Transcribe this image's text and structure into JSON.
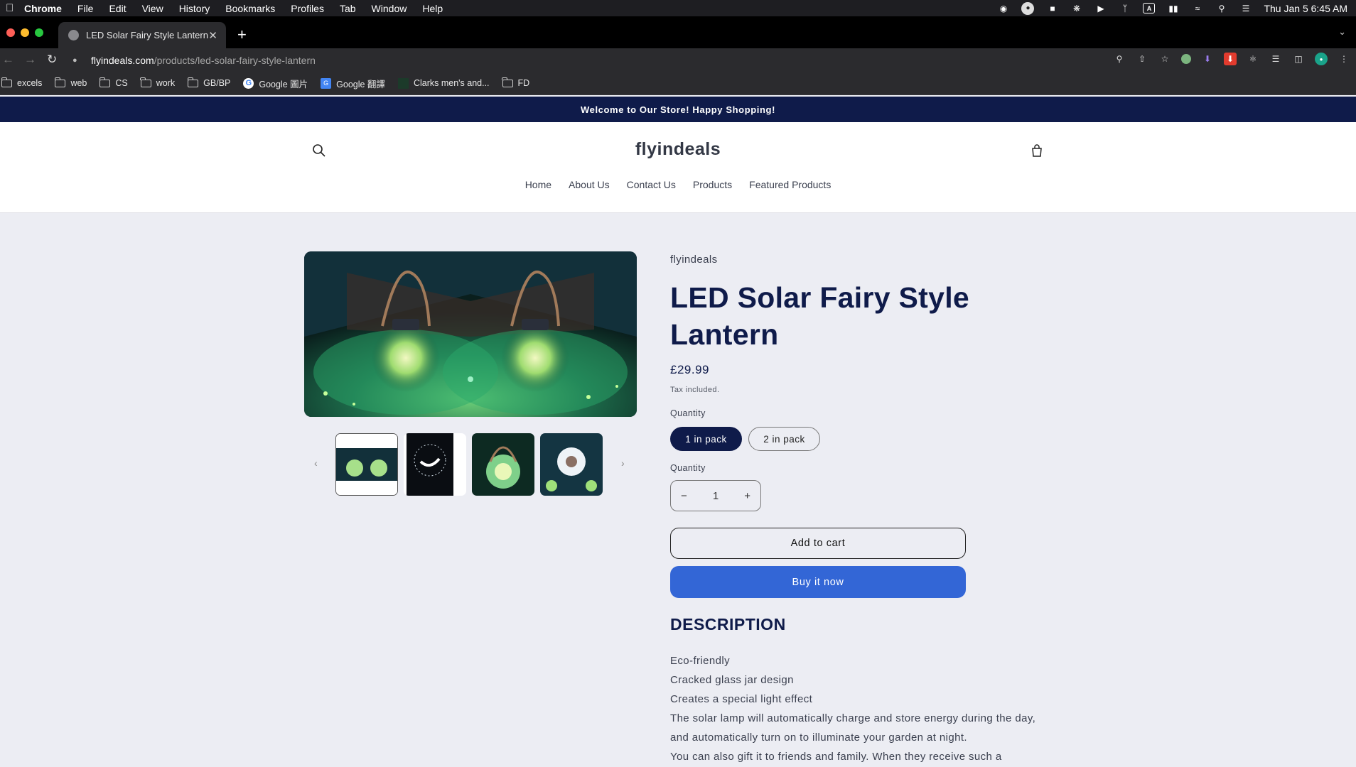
{
  "menubar": {
    "app": "Chrome",
    "items": [
      "File",
      "Edit",
      "View",
      "History",
      "Bookmarks",
      "Profiles",
      "Tab",
      "Window",
      "Help"
    ],
    "clock": "Thu Jan 5  6:45 AM",
    "tray_icons": [
      "wechat-icon",
      "user-circle-icon",
      "line-icon",
      "butterfly-icon",
      "play-icon",
      "bluetooth-icon",
      "keyboard-a-icon",
      "battery-icon",
      "wifi-icon",
      "spotlight-icon",
      "control-center-icon"
    ]
  },
  "tab": {
    "title": "LED Solar Fairy Style Lantern –"
  },
  "address": {
    "host": "flyindeals.com",
    "path": "/products/led-solar-fairy-style-lantern"
  },
  "bookmarks": [
    {
      "label": "excels",
      "icon": "folder-icon"
    },
    {
      "label": "web",
      "icon": "folder-icon"
    },
    {
      "label": "CS",
      "icon": "folder-icon"
    },
    {
      "label": "work",
      "icon": "folder-icon"
    },
    {
      "label": "GB/BP",
      "icon": "folder-icon"
    },
    {
      "label": "Google 圖片",
      "icon": "google-icon"
    },
    {
      "label": "Google 翻譯",
      "icon": "google-translate-icon"
    },
    {
      "label": "Clarks men's and...",
      "icon": "clarks-icon"
    },
    {
      "label": "FD",
      "icon": "folder-icon"
    }
  ],
  "store": {
    "announcement": "Welcome to Our Store! Happy Shopping!",
    "logo": "flyindeals",
    "nav": [
      "Home",
      "About Us",
      "Contact Us",
      "Products",
      "Featured Products"
    ]
  },
  "product": {
    "vendor": "flyindeals",
    "title": "LED Solar Fairy Style Lantern",
    "price": "£29.99",
    "tax_note": "Tax included.",
    "variant_label": "Quantity",
    "variants": [
      "1 in pack",
      "2 in pack"
    ],
    "selected_variant": "1 in pack",
    "quantity_label": "Quantity",
    "quantity": "1",
    "add_to_cart": "Add to cart",
    "buy_now": "Buy it now",
    "description_heading": "DESCRIPTION",
    "description_lines": [
      "Eco-friendly",
      "Cracked glass jar design",
      "Creates a special light effect",
      "The solar lamp will automatically charge and store energy during the day, and automatically turn on to illuminate your garden at night.",
      "You can also gift it to friends and family. When they receive such a"
    ]
  },
  "colors": {
    "navy": "#0F1B4A",
    "buy_button": "#3366D6",
    "page_bg": "#ECEDF3"
  }
}
